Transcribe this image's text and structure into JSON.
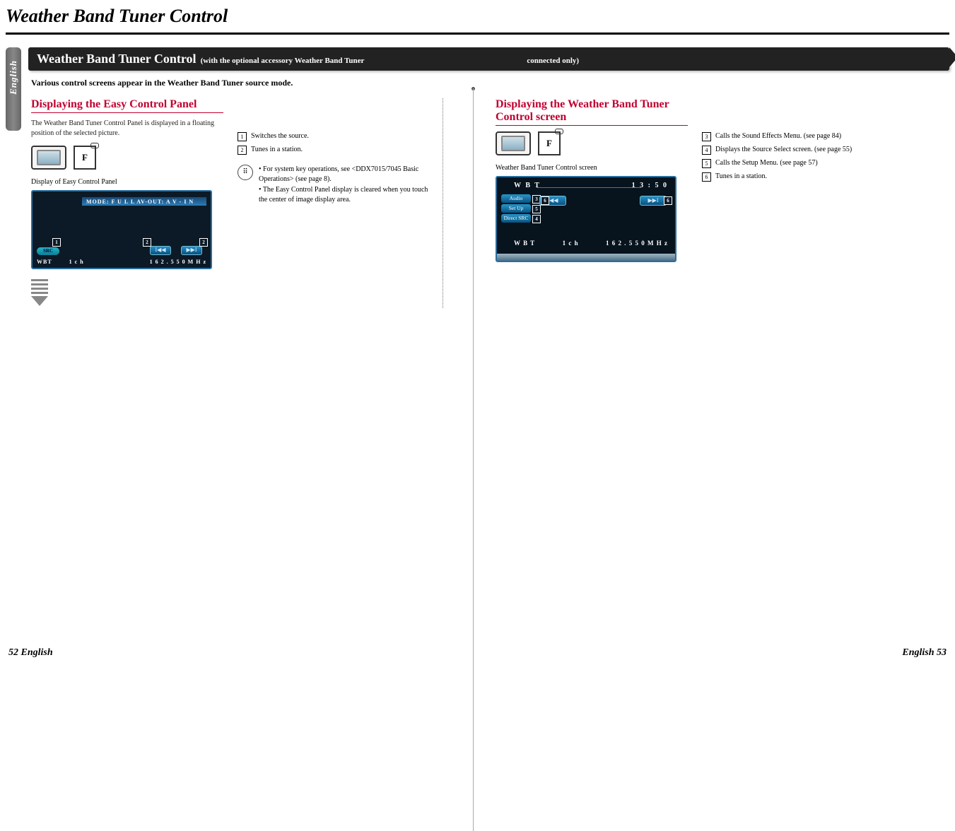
{
  "page_title": "Weather Band Tuner Control",
  "lang_tab": "English",
  "section_bar": {
    "title": "Weather Band Tuner Control",
    "sub": "(with the optional accessory Weather Band Tuner",
    "sub2": "connected only)"
  },
  "intro": "Various control screens appear in the Weather Band Tuner source mode.",
  "left": {
    "heading": "Displaying the Easy Control Panel",
    "desc": "The Weather Band Tuner Control Panel is displayed in a floating position of the selected picture.",
    "caption": "Display of Easy Control Panel",
    "panel": {
      "mode_bar": "MODE: F U L L   AV-OUT: A V - I N",
      "src": "SRC",
      "prev": "I◀◀",
      "next": "▶▶I",
      "status_wbt": "WBT",
      "status_ch": "1 c h",
      "status_freq": "1 6 2 . 5 5 0   M H z",
      "legend1": "Switches the source.",
      "legend2": "Tunes in a station."
    },
    "notes": {
      "n1": "For system key operations, see <DDX7015/7045 Basic Operations> (see page 8).",
      "n2": "The Easy Control Panel display is cleared when you touch the center of image display area."
    }
  },
  "right": {
    "heading": "Displaying the Weather Band Tuner Control screen",
    "caption": "Weather Band Tuner Control screen",
    "panel": {
      "top_label": "W B T",
      "time": "1 3 : 5 0",
      "audio": "Audio",
      "setup": "Set Up",
      "direct": "Direct SRC",
      "prev": "I◀◀",
      "next": "▶▶I",
      "status_wbt": "W B T",
      "status_ch": "1 c h",
      "status_freq": "1 6 2 . 5 5 0   M H z"
    },
    "legend3": "Calls the Sound Effects Menu. (see page 84)",
    "legend4": "Displays the Source Select screen. (see page 55)",
    "legend5": "Calls the Setup Menu. (see page 57)",
    "legend6": "Tunes in a station."
  },
  "footer": {
    "left": "52 English",
    "right": "English 53"
  },
  "icons": {
    "f": "F"
  }
}
